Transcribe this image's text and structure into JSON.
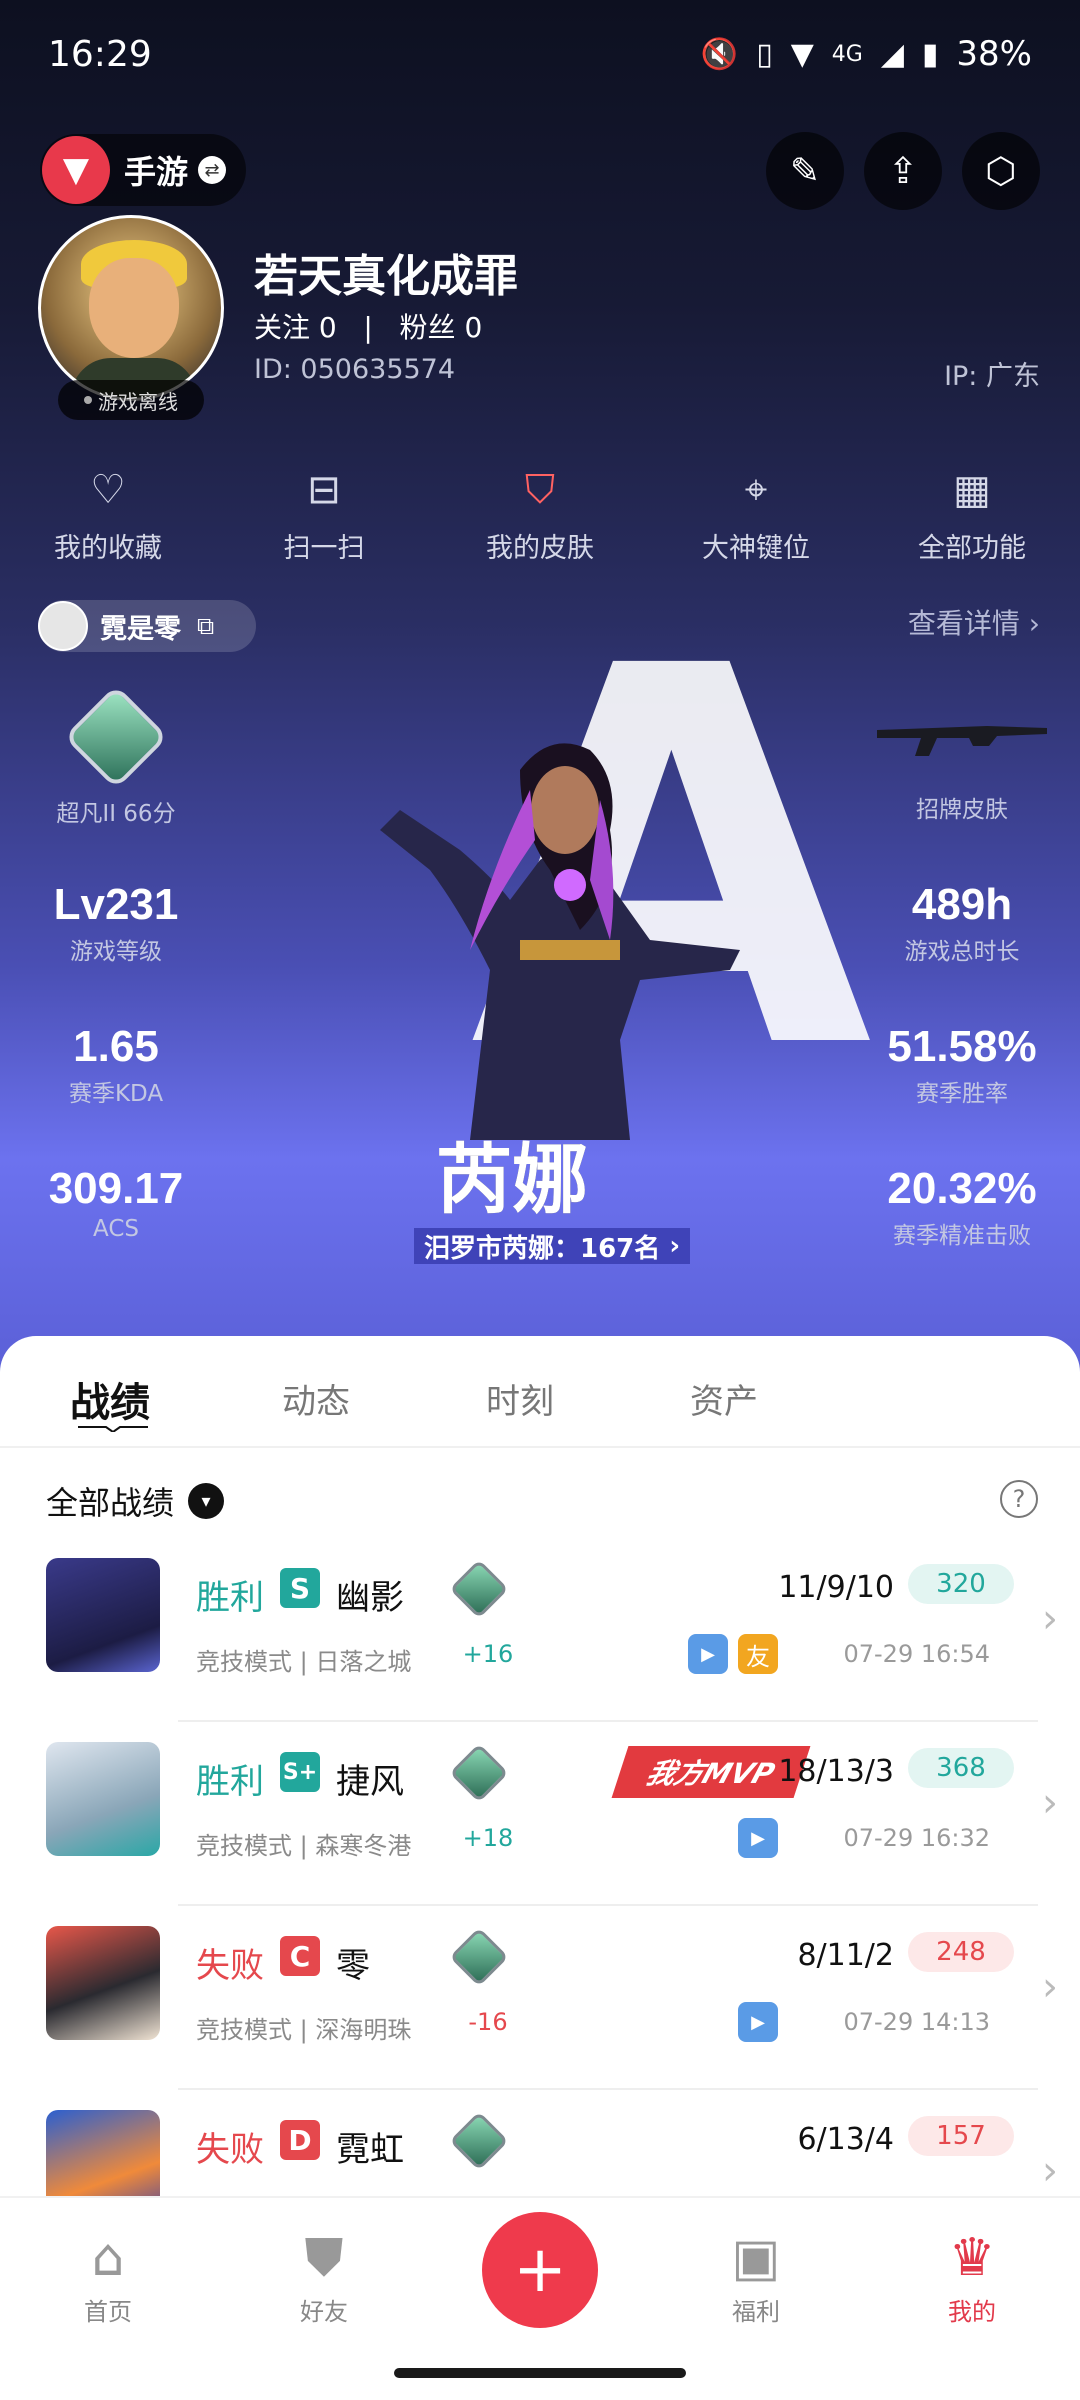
{
  "status_bar": {
    "time": "16:29",
    "network": "4G",
    "battery": "38%"
  },
  "header": {
    "game_switch_label": "手游"
  },
  "profile": {
    "username": "若天真化成罪",
    "follow_text": "关注 0   |   粉丝 0",
    "id_text": "ID: 050635574",
    "ip_text": "IP: 广东",
    "status_label": "游戏离线"
  },
  "quick_actions": [
    {
      "label": "我的收藏",
      "icon": "heart-icon"
    },
    {
      "label": "扫一扫",
      "icon": "scan-icon"
    },
    {
      "label": "我的皮肤",
      "icon": "skin-icon"
    },
    {
      "label": "大神键位",
      "icon": "crosshair-icon"
    },
    {
      "label": "全部功能",
      "icon": "grid-icon"
    }
  ],
  "account": {
    "name": "霓是零",
    "details_label": "查看详情"
  },
  "stats": {
    "rank_label": "超凡II 66分",
    "skin_label": "招牌皮肤",
    "level_value": "Lv231",
    "level_label": "游戏等级",
    "hours_value": "489h",
    "hours_label": "游戏总时长",
    "kda_value": "1.65",
    "kda_label": "赛季KDA",
    "winrate_value": "51.58%",
    "winrate_label": "赛季胜率",
    "acs_value": "309.17",
    "acs_label": "ACS",
    "precision_value": "20.32%",
    "precision_label": "赛季精准击败"
  },
  "agent": {
    "name": "芮娜",
    "rank_text": "汨罗市芮娜：167名"
  },
  "tabs": [
    "战绩",
    "动态",
    "时刻",
    "资产"
  ],
  "filter_label": "全部战绩",
  "matches": [
    {
      "result": "胜利",
      "grade": "S",
      "agent": "幽影",
      "mode": "竞技模式 | 日落之城",
      "delta": "+16",
      "kda": "11/9/10",
      "acs": "320",
      "time": "07-29 16:54",
      "friend": "友",
      "outcome": "win"
    },
    {
      "result": "胜利",
      "grade": "S+",
      "agent": "捷风",
      "mode": "竞技模式 | 森寒冬港",
      "delta": "+18",
      "kda": "18/13/3",
      "acs": "368",
      "time": "07-29 16:32",
      "mvp": "我方MVP",
      "outcome": "win"
    },
    {
      "result": "失败",
      "grade": "C",
      "agent": "零",
      "mode": "竞技模式 | 深海明珠",
      "delta": "-16",
      "kda": "8/11/2",
      "acs": "248",
      "time": "07-29 14:13",
      "outcome": "lose"
    },
    {
      "result": "失败",
      "grade": "D",
      "agent": "霓虹",
      "kda": "6/13/4",
      "acs": "157",
      "outcome": "lose"
    }
  ],
  "bottom_nav": [
    {
      "label": "首页",
      "icon": "home-icon"
    },
    {
      "label": "好友",
      "icon": "friends-icon"
    },
    {
      "label": "福利",
      "icon": "gift-icon"
    },
    {
      "label": "我的",
      "icon": "profile-icon"
    }
  ],
  "colors": {
    "accent": "#ef3a4c",
    "win": "#22a79c",
    "lose": "#e5484d"
  }
}
